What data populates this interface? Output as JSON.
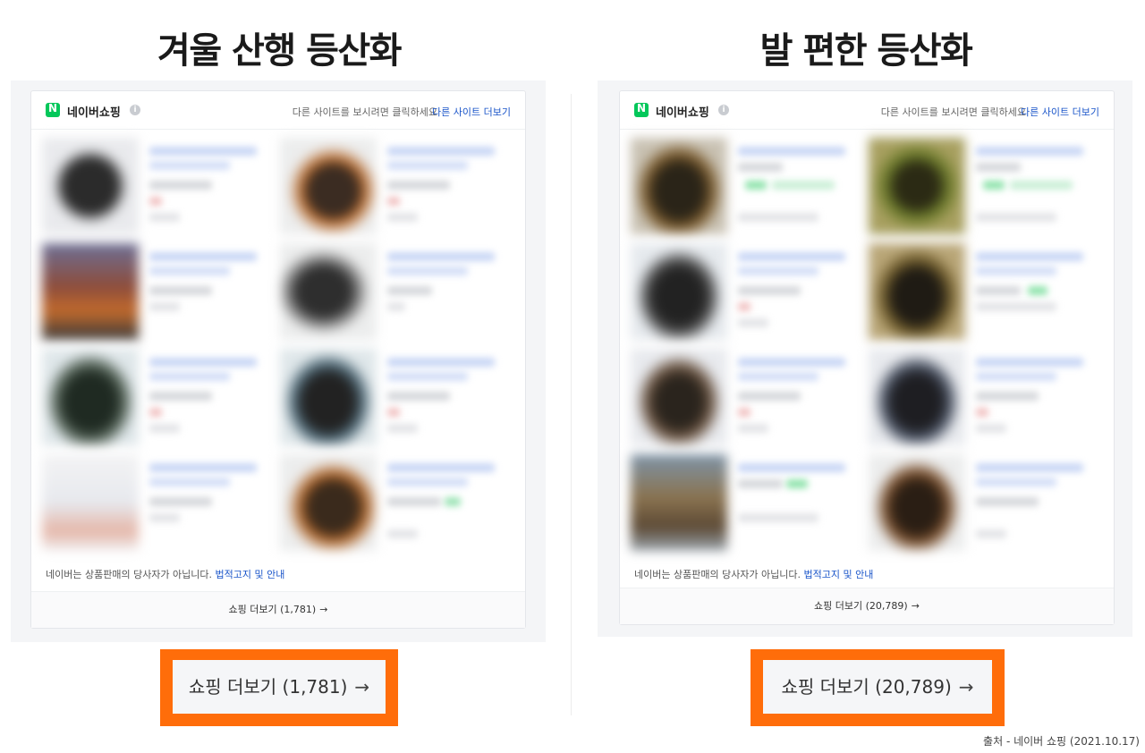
{
  "left": {
    "title": "겨울 산행 등산화",
    "panel": {
      "brand": "네이버쇼핑",
      "info_icon": "info-icon",
      "hint": "다른 사이트를 보시려면 클릭하세요",
      "more_sites": "다른 사이트 더보기",
      "notice": "네이버는 상품판매의 당사자가 아닙니다.",
      "notice_link": "법적고지 및 안내",
      "footer_label": "쇼핑 더보기 (1,781)",
      "footer_arrow": "→"
    },
    "cta_label": "쇼핑 더보기 (1,781)",
    "cta_arrow": "→"
  },
  "right": {
    "title": "발 편한 등산화",
    "panel": {
      "brand": "네이버쇼핑",
      "info_icon": "info-icon",
      "hint": "다른 사이트를 보시려면 클릭하세요",
      "more_sites": "다른 사이트 더보기",
      "notice": "네이버는 상품판매의 당사자가 아닙니다.",
      "notice_link": "법적고지 및 안내",
      "footer_label": "쇼핑 더보기 (20,789)",
      "footer_arrow": "→"
    },
    "cta_label": "쇼핑 더보기 (20,789)",
    "cta_arrow": "→"
  },
  "source": "출처 - 네이버 쇼핑 (2021.10.17)",
  "colors": {
    "accent_orange": "#ff6d0a",
    "naver_green": "#03c75a",
    "link_blue": "#1a55c9"
  }
}
